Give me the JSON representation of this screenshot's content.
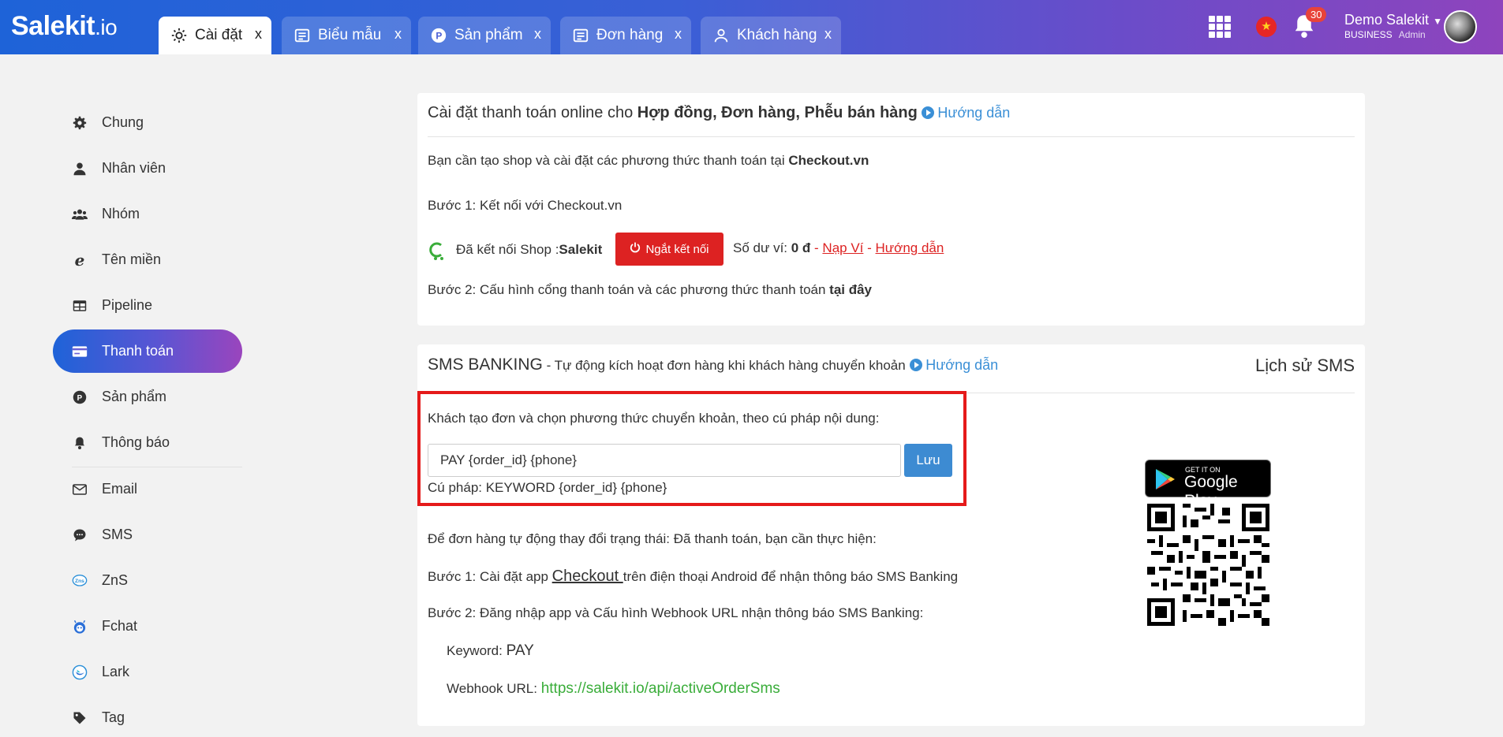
{
  "header": {
    "logo_main": "Salekit",
    "logo_suffix": ".io",
    "tabs": [
      {
        "label": "Cài đặt",
        "close": "x"
      },
      {
        "label": "Biểu mẫu",
        "close": "x"
      },
      {
        "label": "Sản phẩm",
        "close": "x"
      },
      {
        "label": "Đơn hàng",
        "close": "x"
      },
      {
        "label": "Khách hàng",
        "close": "x"
      }
    ],
    "notification_count": "30",
    "user_name": "Demo Salekit",
    "user_plan": "BUSINESS",
    "user_role": "Admin"
  },
  "sidebar": {
    "items": [
      {
        "label": "Chung",
        "icon": "gear-icon"
      },
      {
        "label": "Nhân viên",
        "icon": "user-icon"
      },
      {
        "label": "Nhóm",
        "icon": "users-icon"
      },
      {
        "label": "Tên miền",
        "icon": "browser-icon"
      },
      {
        "label": "Pipeline",
        "icon": "table-icon"
      },
      {
        "label": "Thanh toán",
        "icon": "credit-card-icon"
      },
      {
        "label": "Sản phẩm",
        "icon": "product-icon"
      },
      {
        "label": "Thông báo",
        "icon": "bell-icon"
      },
      {
        "label": "Email",
        "icon": "envelope-icon"
      },
      {
        "label": "SMS",
        "icon": "chat-icon"
      },
      {
        "label": "ZnS",
        "icon": "zns-icon"
      },
      {
        "label": "Fchat",
        "icon": "robot-icon"
      },
      {
        "label": "Lark",
        "icon": "lark-icon"
      },
      {
        "label": "Tag",
        "icon": "tag-icon"
      }
    ],
    "active_index": 5
  },
  "online_payment": {
    "title_prefix": "Cài đặt thanh toán online cho ",
    "title_bold": "Hợp đồng, Đơn hàng, Phễu bán hàng",
    "guide_link": "Hướng dẫn",
    "intro_text": "Bạn cần tạo shop và cài đặt các phương thức thanh toán tại ",
    "intro_bold": "Checkout.vn",
    "step1": "Bước 1: Kết nối với Checkout.vn",
    "connected_text": "Đã kết nối Shop : ",
    "shop_name": "Salekit",
    "disconnect_button": "Ngắt kết nối",
    "balance_label": "Số dư ví: ",
    "balance_value": "0 đ",
    "separator": " - ",
    "topup_link": "Nạp Ví",
    "balance_guide_link": "Hướng dẫn",
    "step2_text": "Bước 2: Cấu hình cổng thanh toán và các phương thức thanh toán ",
    "step2_bold": "tại đây"
  },
  "sms_banking": {
    "title": "SMS BANKING",
    "subtitle": " - Tự động kích hoạt đơn hàng khi khách hàng chuyển khoản",
    "guide_link": "Hướng dẫn",
    "history_link": "Lịch sử SMS",
    "instruction": "Khách tạo đơn và chọn phương thức chuyển khoản, theo cú pháp nội dung:",
    "syntax_value": "PAY {order_id} {phone}",
    "save_button": "Lưu",
    "syntax_hint": "Cú pháp: KEYWORD {order_id} {phone}",
    "auto_status_text": "Để đơn hàng tự động thay đổi trạng thái: Đã thanh toán, bạn cần thực hiện:",
    "step1_prefix": "Bước 1: Cài đặt app ",
    "step1_link": "Checkout ",
    "step1_suffix": "trên điện thoại Android để nhận thông báo SMS Banking",
    "step2": "Bước 2: Đăng nhập app và Cấu hình Webhook URL nhận thông báo SMS Banking:",
    "keyword_label": "Keyword: ",
    "keyword_value": "PAY",
    "webhook_label": "Webhook URL: ",
    "webhook_value": "https://salekit.io/api/activeOrderSms",
    "gplay_small": "GET IT ON",
    "gplay_large": "Google Play"
  },
  "colors": {
    "brand_start": "#1e63d8",
    "brand_end": "#8e44bd",
    "danger": "#dd2222",
    "primary_button": "#3d8bd2",
    "link": "#3a8fd6",
    "webhook": "#3aad3a"
  }
}
